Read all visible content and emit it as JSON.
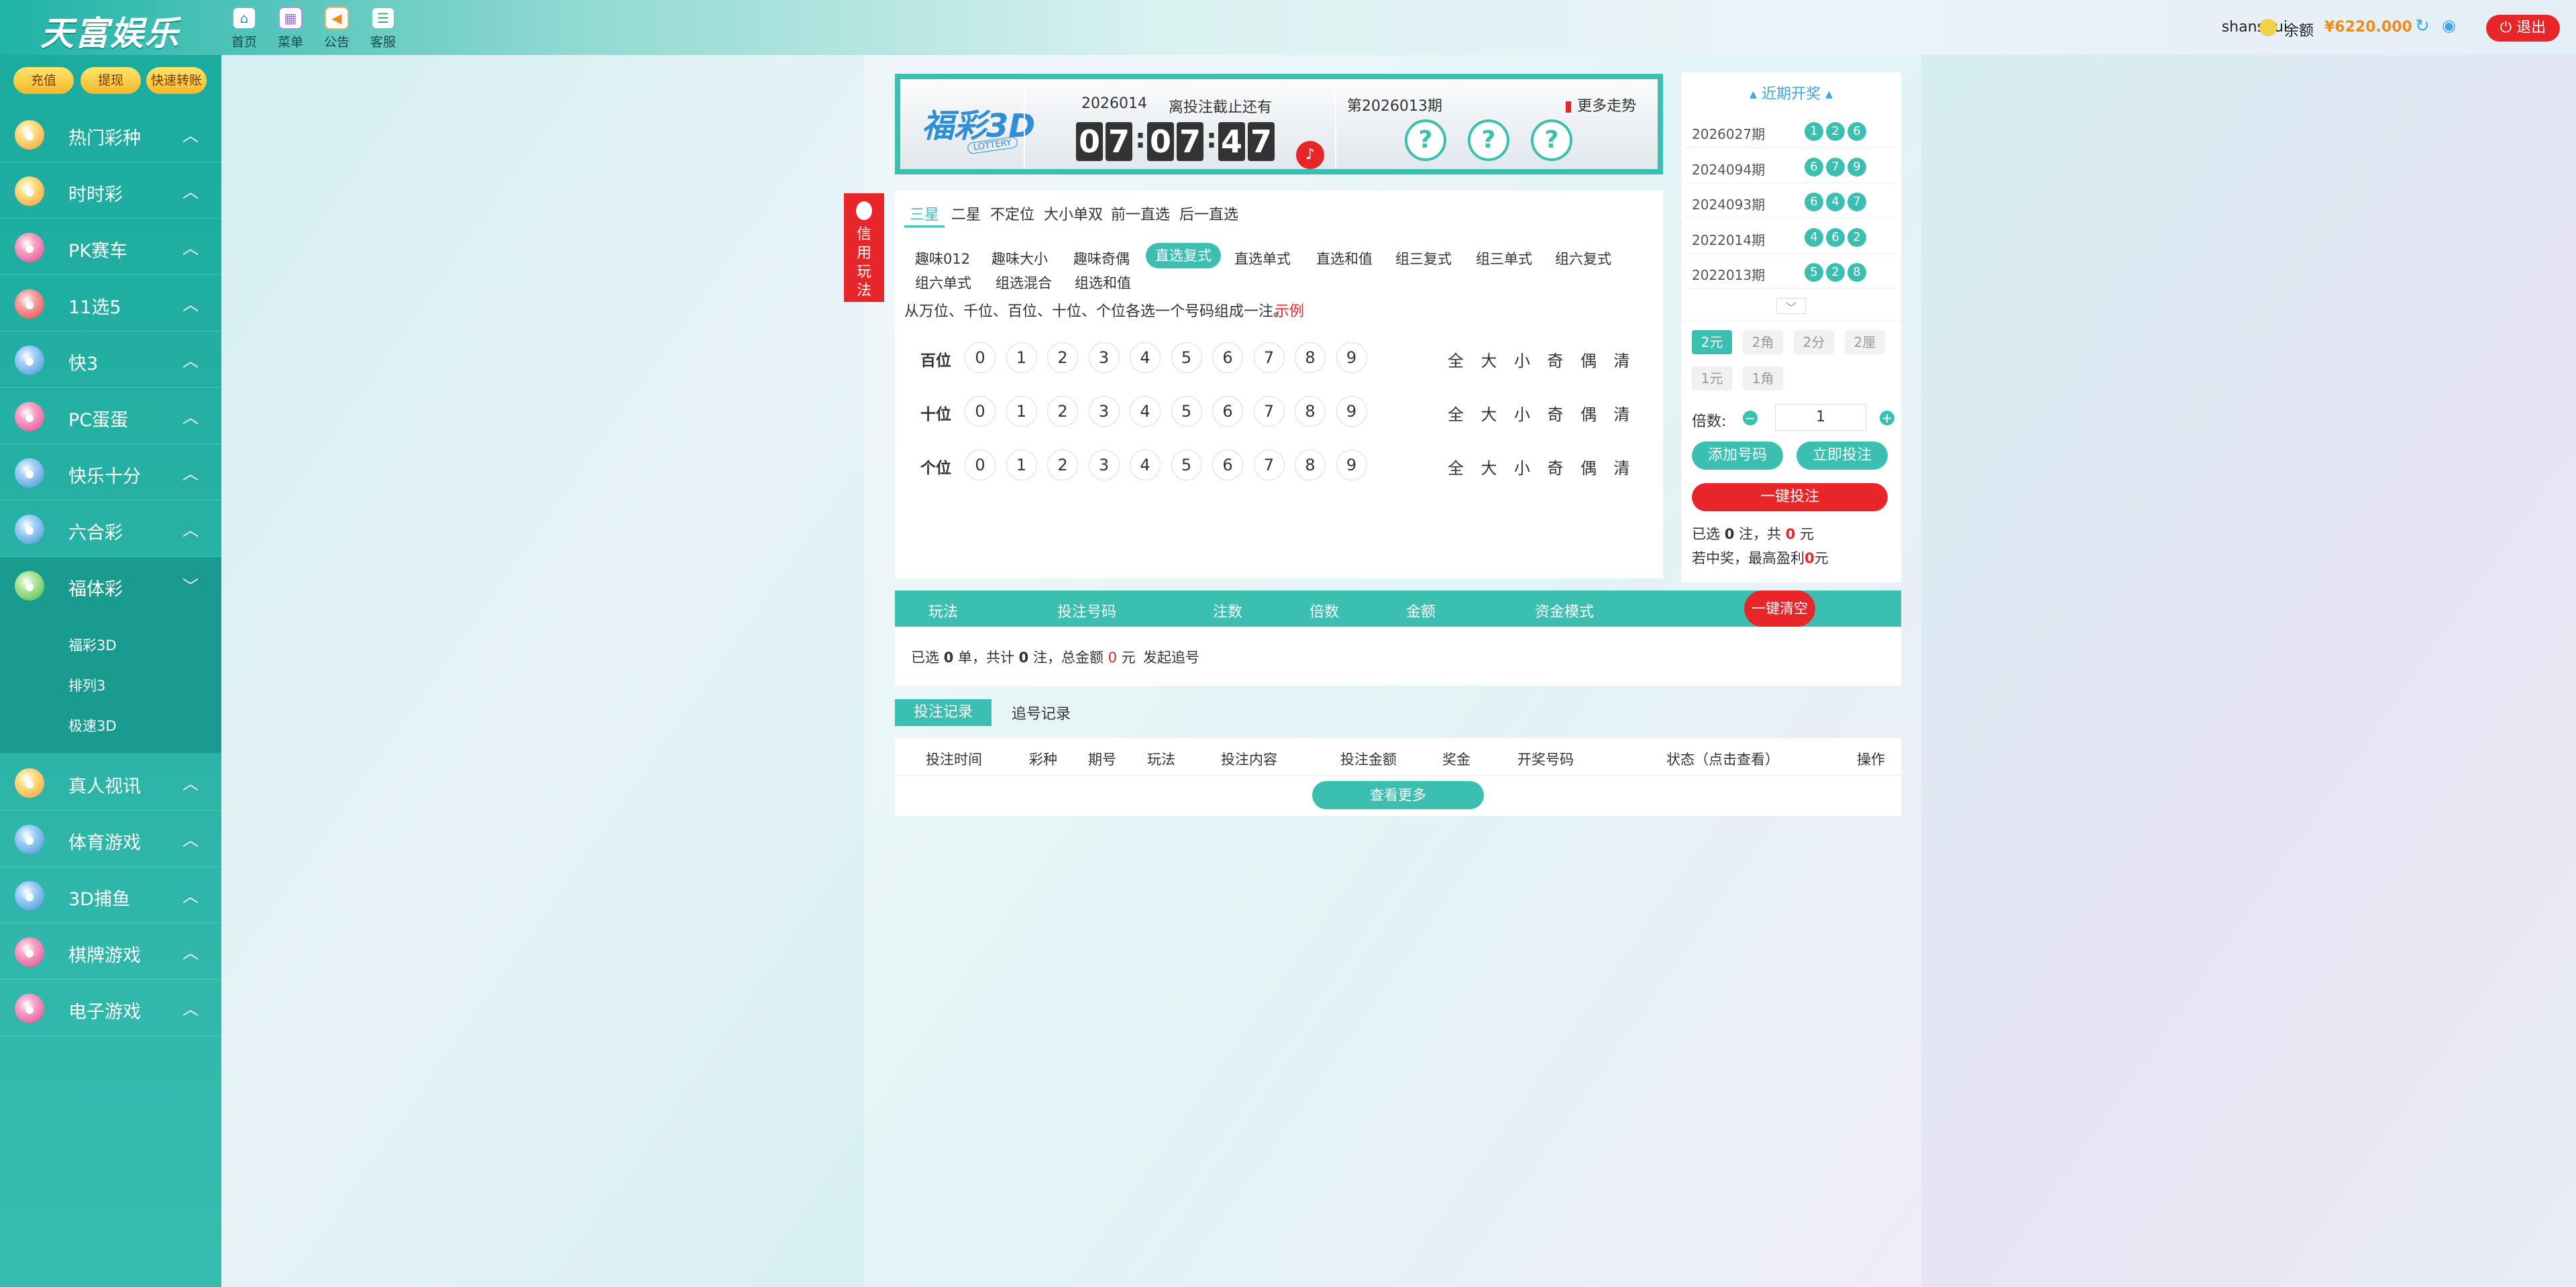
{
  "brand": {
    "logo": "天富娱乐"
  },
  "topnav": [
    {
      "label": "首页",
      "icon": "home-icon"
    },
    {
      "label": "菜单",
      "icon": "menu-icon"
    },
    {
      "label": "公告",
      "icon": "announcement-icon"
    },
    {
      "label": "客服",
      "icon": "support-icon"
    }
  ],
  "user": {
    "name": "shanshui",
    "balance_label": "余额",
    "balance": "¥6220.000",
    "logout": "退出"
  },
  "quick_buttons": {
    "recharge": "充值",
    "withdraw": "提现",
    "transfer": "快速转账"
  },
  "sidebar": {
    "items": [
      {
        "label": "热门彩种"
      },
      {
        "label": "时时彩"
      },
      {
        "label": "PK赛车"
      },
      {
        "label": "11选5"
      },
      {
        "label": "快3"
      },
      {
        "label": "PC蛋蛋"
      },
      {
        "label": "快乐十分"
      },
      {
        "label": "六合彩"
      },
      {
        "label": "福体彩"
      },
      {
        "label": "真人视讯"
      },
      {
        "label": "体育游戏"
      },
      {
        "label": "3D捕鱼"
      },
      {
        "label": "棋牌游戏"
      },
      {
        "label": "电子游戏"
      }
    ],
    "subitems": [
      "福彩3D",
      "排列3",
      "极速3D"
    ]
  },
  "game": {
    "logo": "福彩3D",
    "logo_sub": "LOTTERY",
    "current_issue": "2026014",
    "cutoff_label": "离投注截止还有",
    "countdown": [
      "0",
      "7",
      "0",
      "7",
      "4",
      "7"
    ],
    "prev_issue": "第2026013期",
    "trend": "更多走势",
    "result_placeholder": [
      "?",
      "?",
      "?"
    ]
  },
  "credit": {
    "label": "信用玩法"
  },
  "play": {
    "tabs": [
      "三星",
      "二星",
      "不定位",
      "大小单双",
      "前一直选",
      "后一直选"
    ],
    "subtabs": [
      "趣味012",
      "趣味大小",
      "趣味奇偶",
      "直选复式",
      "直选单式",
      "直选和值",
      "组三复式",
      "组三单式",
      "组六复式",
      "组六单式",
      "组选混合",
      "组选和值"
    ],
    "description": "从万位、千位、百位、十位、个位各选一个号码组成一注。",
    "example": "示例",
    "rows": [
      {
        "label": "百位"
      },
      {
        "label": "十位"
      },
      {
        "label": "个位"
      }
    ],
    "digits": [
      "0",
      "1",
      "2",
      "3",
      "4",
      "5",
      "6",
      "7",
      "8",
      "9"
    ],
    "quick": [
      "全",
      "大",
      "小",
      "奇",
      "偶",
      "清"
    ]
  },
  "recent": {
    "title": "近期开奖",
    "draws": [
      {
        "issue": "2026027期",
        "nums": [
          "1",
          "2",
          "6"
        ]
      },
      {
        "issue": "2024094期",
        "nums": [
          "6",
          "7",
          "9"
        ]
      },
      {
        "issue": "2024093期",
        "nums": [
          "6",
          "4",
          "7"
        ]
      },
      {
        "issue": "2022014期",
        "nums": [
          "4",
          "6",
          "2"
        ]
      },
      {
        "issue": "2022013期",
        "nums": [
          "5",
          "2",
          "8"
        ]
      }
    ]
  },
  "bet": {
    "units": [
      "2元",
      "2角",
      "2分",
      "2厘",
      "1元",
      "1角"
    ],
    "multiple_label": "倍数:",
    "multiple_value": "1",
    "add_number": "添加号码",
    "bet_now": "立即投注",
    "one_key": "一键投注",
    "summary_prefix": "已选 ",
    "summary_count": "0",
    "summary_mid": " 注，共 ",
    "summary_amount": "0",
    "summary_suffix": " 元",
    "profit_prefix": "若中奖，最高盈利",
    "profit_value": "0",
    "profit_suffix": "元"
  },
  "cart": {
    "headers": [
      "玩法",
      "投注号码",
      "注数",
      "倍数",
      "金额",
      "资金模式"
    ],
    "clear": "一键清空",
    "summary": [
      "已选 ",
      "0",
      " 单，共计 ",
      "0",
      " 注，总金额 ",
      "0",
      " 元"
    ],
    "chase": "发起追号"
  },
  "records": {
    "tab_bets": "投注记录",
    "tab_chase": "追号记录",
    "headers": [
      "投注时间",
      "彩种",
      "期号",
      "玩法",
      "投注内容",
      "投注金额",
      "奖金",
      "开奖号码",
      "状态（点击查看）",
      "操作"
    ],
    "view_more": "查看更多"
  },
  "colors": {
    "accent": "#3bbfb1",
    "danger": "#e8262a",
    "balance": "#f28a1c"
  }
}
